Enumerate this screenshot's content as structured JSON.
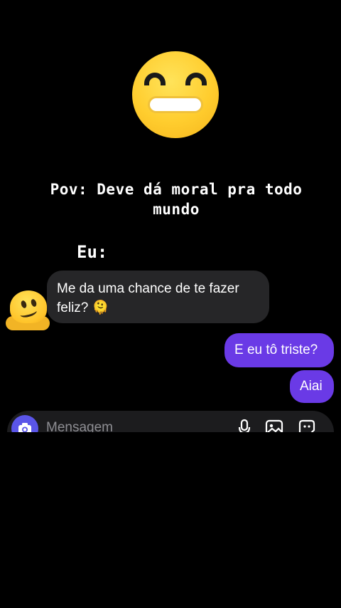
{
  "caption": {
    "line1": "Pov: Deve dá moral pra todo",
    "line2": "mundo",
    "speaker": "Eu:"
  },
  "messages": {
    "incoming": {
      "text": "Me da uma chance de te fazer feliz? 🫠",
      "avatar": "melting-face-emoji"
    },
    "outgoing": [
      {
        "text": "E eu tô triste?"
      },
      {
        "text": "Aiai"
      }
    ]
  },
  "composer": {
    "placeholder": "Mensagem",
    "icons": [
      "camera-icon",
      "microphone-icon",
      "gallery-icon",
      "sticker-icon"
    ]
  },
  "colors": {
    "outgoing_bubble": "#6a3ae6",
    "incoming_bubble": "#262628",
    "camera_button": "#5a55e8"
  },
  "top_emoji": "grinning-face-emoji"
}
